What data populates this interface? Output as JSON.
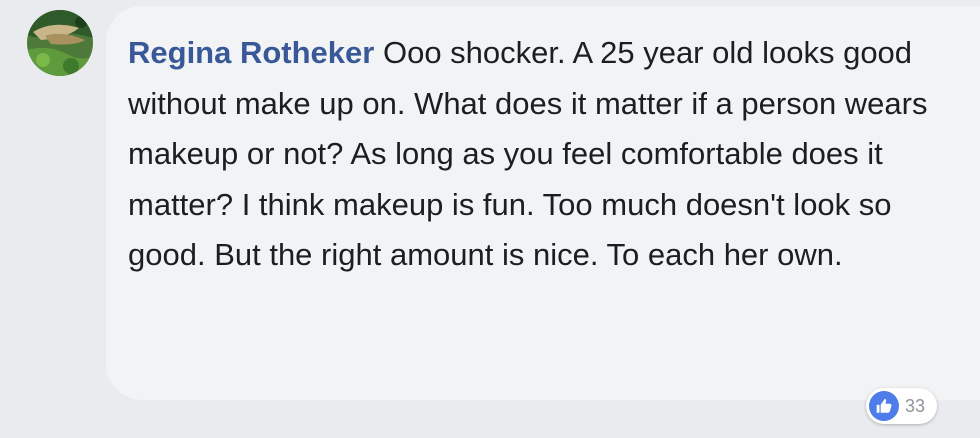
{
  "comment": {
    "author": "Regina Rotheker",
    "text": "Ooo shocker. A 25 year old looks good without make up on. What does it matter if a person wears makeup or not? As long as you feel comfortable does it matter? I think makeup is fun. Too much doesn't look so good. But the right amount is nice. To each her own.",
    "reactions": {
      "icon": "like-icon",
      "count": "33"
    }
  },
  "colors": {
    "author_link": "#385898",
    "bubble_bg": "#f2f3f5",
    "page_bg": "#e9ebee",
    "like_blue": "#4e7de9"
  }
}
